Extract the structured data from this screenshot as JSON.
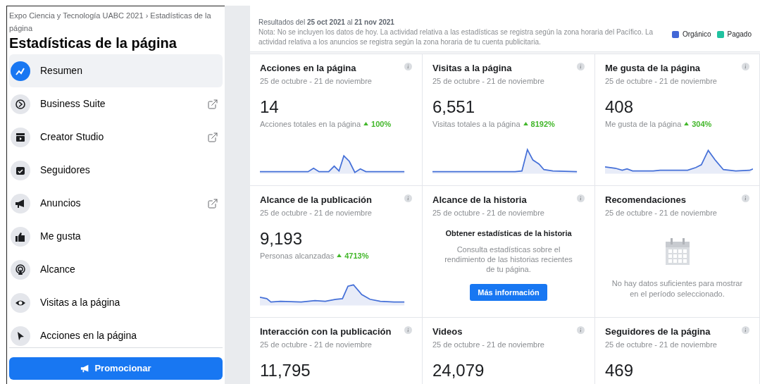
{
  "sidebar": {
    "breadcrumb": "Expo Ciencia y Tecnología UABC 2021 › Estadísticas de la página",
    "title": "Estadísticas de la página",
    "items": [
      {
        "label": "Resumen",
        "selected": true,
        "external": false
      },
      {
        "label": "Business Suite",
        "selected": false,
        "external": true
      },
      {
        "label": "Creator Studio",
        "selected": false,
        "external": true
      },
      {
        "label": "Seguidores",
        "selected": false,
        "external": false
      },
      {
        "label": "Anuncios",
        "selected": false,
        "external": true
      },
      {
        "label": "Me gusta",
        "selected": false,
        "external": false
      },
      {
        "label": "Alcance",
        "selected": false,
        "external": false
      },
      {
        "label": "Visitas a la página",
        "selected": false,
        "external": false
      },
      {
        "label": "Acciones en la página",
        "selected": false,
        "external": false
      }
    ],
    "promote_button": "Promocionar"
  },
  "header": {
    "results": "Resultados del **25 oct 2021** al **21 nov 2021**",
    "note": "Nota: No se incluyen los datos de hoy. La actividad relativa a las estadísticas se registra según la zona horaria del Pacífico. La actividad relativa a los anuncios se registra según la zona horaria de tu cuenta publicitaria.",
    "legend": [
      {
        "label": "Orgánico",
        "color": "#4267d6"
      },
      {
        "label": "Pagado",
        "color": "#20c2a0"
      }
    ]
  },
  "cards": [
    {
      "kind": "metric",
      "title": "Acciones en la página",
      "range": "25 de octubre - 21 de noviembre",
      "value": "14",
      "caption": "Acciones totales en la página",
      "change": "100%"
    },
    {
      "kind": "metric",
      "title": "Visitas a la página",
      "range": "25 de octubre - 21 de noviembre",
      "value": "6,551",
      "caption": "Visitas totales a la página",
      "change": "8192%"
    },
    {
      "kind": "metric",
      "title": "Me gusta de la página",
      "range": "25 de octubre - 21 de noviembre",
      "value": "408",
      "caption": "Me gusta de la página",
      "change": "304%"
    },
    {
      "kind": "metric",
      "title": "Alcance de la publicación",
      "range": "25 de octubre - 21 de noviembre",
      "value": "9,193",
      "caption": "Personas alcanzadas",
      "change": "4713%"
    },
    {
      "kind": "promo",
      "title": "Alcance de la historia",
      "range": "25 de octubre - 21 de noviembre",
      "heading": "Obtener estadísticas de la historia",
      "text": "Consulta estadísticas sobre el rendimiento de las historias recientes de tu página.",
      "button": "Más información"
    },
    {
      "kind": "empty",
      "title": "Recomendaciones",
      "range": "25 de octubre - 21 de noviembre",
      "text": "No hay datos suficientes para mostrar en el período seleccionado."
    },
    {
      "kind": "partial",
      "title": "Interacción con la publicación",
      "range": "25 de octubre - 21 de noviembre",
      "value": "11,795"
    },
    {
      "kind": "partial",
      "title": "Videos",
      "range": "25 de octubre - 21 de noviembre",
      "value": "24,079"
    },
    {
      "kind": "partial",
      "title": "Seguidores de la página",
      "range": "25 de octubre - 21 de noviembre",
      "value": "469"
    }
  ]
}
